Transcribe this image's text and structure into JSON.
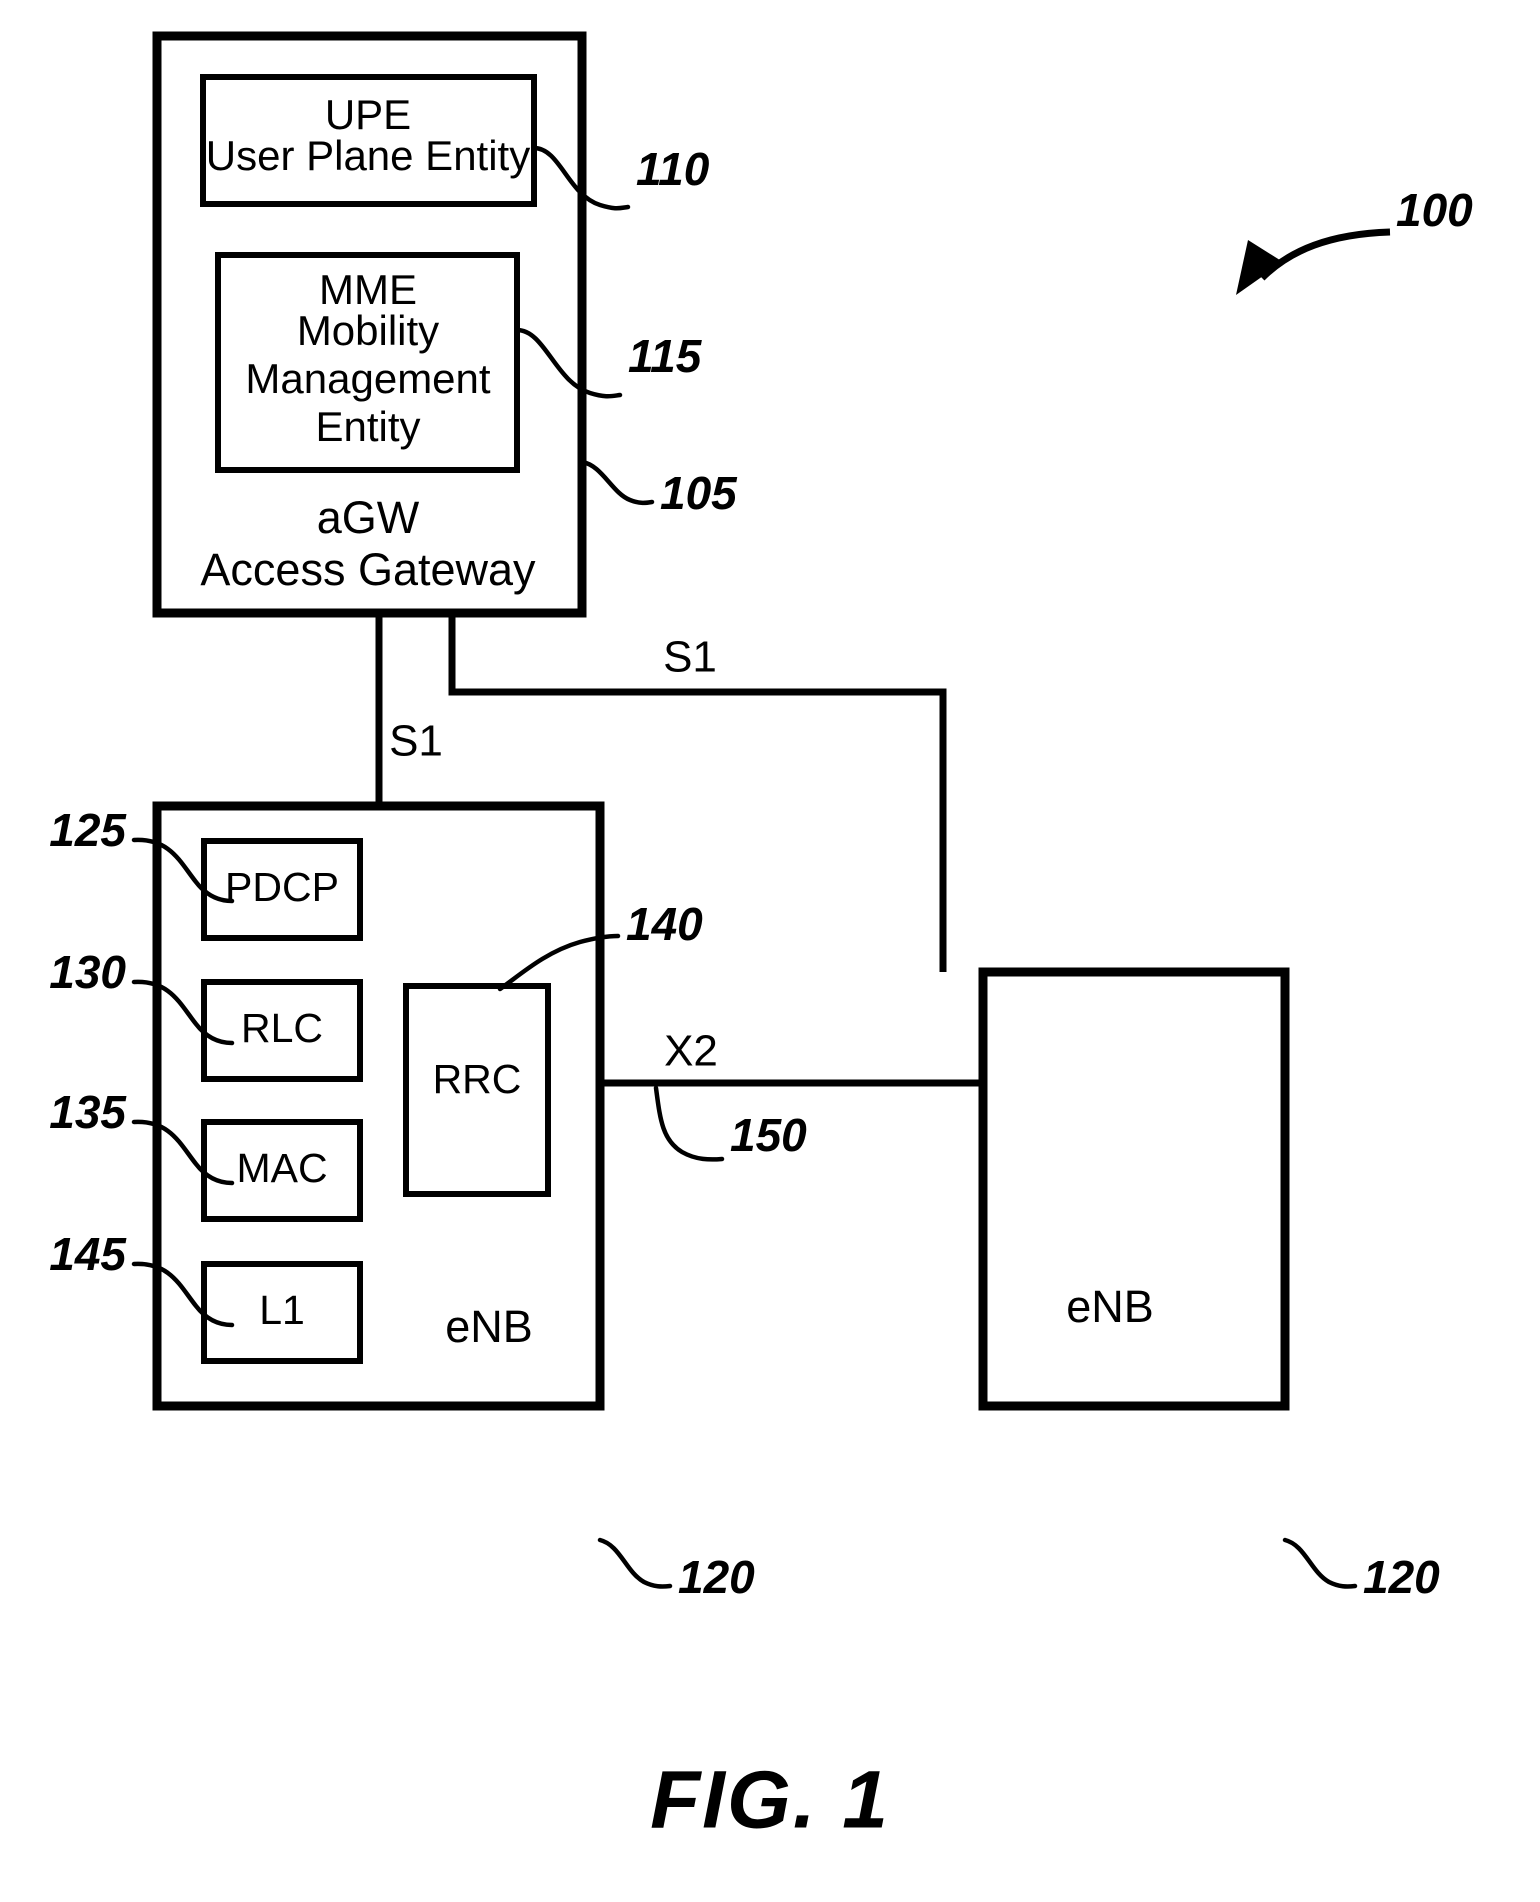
{
  "figure": {
    "caption": "FIG. 1",
    "system_ref": "100"
  },
  "nodes": {
    "agw": {
      "name_abbrev": "aGW",
      "name_full": "Access Gateway",
      "ref": "105",
      "children": [
        {
          "id": "upe",
          "lines": [
            "UPE",
            "User Plane Entity"
          ],
          "ref": "110"
        },
        {
          "id": "mme",
          "lines": [
            "MME",
            "Mobility",
            "Management",
            "Entity"
          ],
          "ref": "115"
        }
      ]
    },
    "enb_left": {
      "name_abbrev": "eNB",
      "ref": "120",
      "layers": [
        {
          "id": "pdcp",
          "label": "PDCP",
          "ref": "125"
        },
        {
          "id": "rlc",
          "label": "RLC",
          "ref": "130"
        },
        {
          "id": "mac",
          "label": "MAC",
          "ref": "135"
        },
        {
          "id": "l1",
          "label": "L1",
          "ref": "145"
        }
      ],
      "control": {
        "id": "rrc",
        "label": "RRC",
        "ref": "140"
      }
    },
    "enb_right": {
      "name_abbrev": "eNB",
      "ref": "120"
    }
  },
  "interfaces": [
    {
      "id": "s1_top",
      "label": "S1"
    },
    {
      "id": "s1_left",
      "label": "S1"
    },
    {
      "id": "x2",
      "label": "X2",
      "ref": "150"
    }
  ],
  "colors": {
    "stroke": "#000000",
    "background": "#ffffff"
  }
}
